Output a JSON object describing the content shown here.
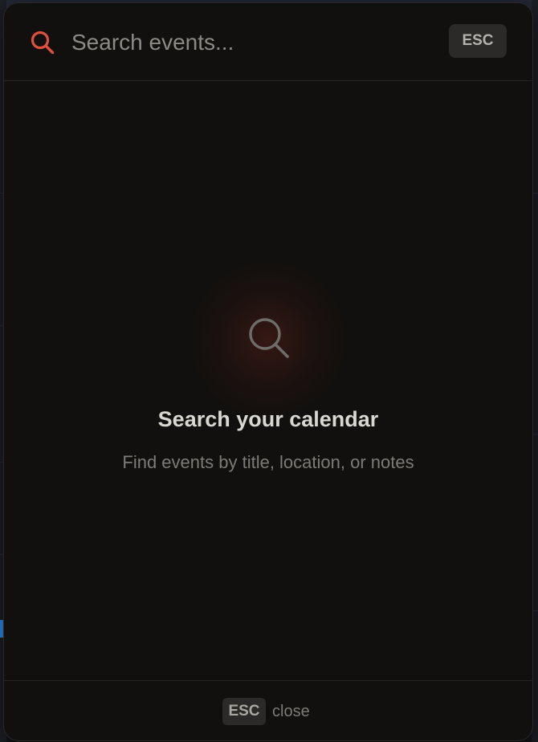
{
  "search": {
    "placeholder": "Search events...",
    "value": "",
    "esc_label": "ESC"
  },
  "empty_state": {
    "title": "Search your calendar",
    "subtitle": "Find events by title, location, or notes"
  },
  "footer": {
    "key": "ESC",
    "label": "close"
  },
  "colors": {
    "accent": "#e0503e",
    "modal_bg": "#11100e",
    "text_primary": "#d9d7d2",
    "text_muted": "#7d7b76"
  },
  "icons": {
    "search": "search-icon",
    "empty": "magnifier-icon"
  }
}
